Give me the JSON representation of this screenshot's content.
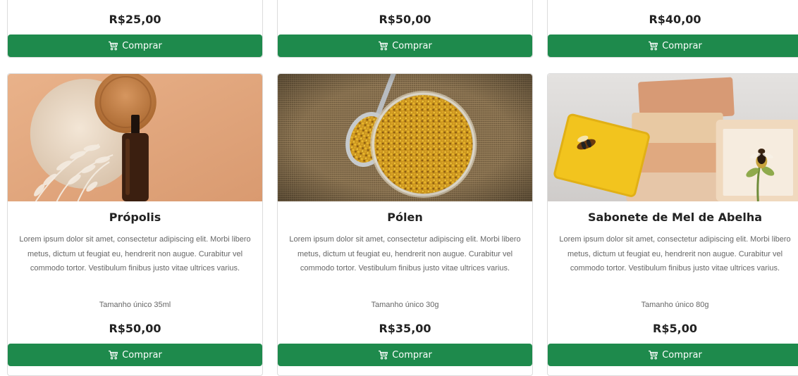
{
  "top_row": [
    {
      "price": "R$25,00",
      "button": "Comprar"
    },
    {
      "price": "R$50,00",
      "button": "Comprar"
    },
    {
      "price": "R$40,00",
      "button": "Comprar"
    }
  ],
  "products": [
    {
      "title": "Própolis",
      "description": "Lorem ipsum dolor sit amet, consectetur adipiscing elit. Morbi libero metus, dictum ut feugiat eu, hendrerit non augue. Curabitur vel commodo tortor. Vestibulum finibus justo vitae ultrices varius.",
      "size": "Tamanho único 35ml",
      "price": "R$50,00",
      "button": "Comprar"
    },
    {
      "title": "Pólen",
      "description": "Lorem ipsum dolor sit amet, consectetur adipiscing elit. Morbi libero metus, dictum ut feugiat eu, hendrerit non augue. Curabitur vel commodo tortor. Vestibulum finibus justo vitae ultrices varius.",
      "size": "Tamanho único 30g",
      "price": "R$35,00",
      "button": "Comprar"
    },
    {
      "title": "Sabonete de Mel de Abelha",
      "description": "Lorem ipsum dolor sit amet, consectetur adipiscing elit. Morbi libero metus, dictum ut feugiat eu, hendrerit non augue. Curabitur vel commodo tortor. Vestibulum finibus justo vitae ultrices varius.",
      "size": "Tamanho único 80g",
      "price": "R$5,00",
      "button": "Comprar"
    }
  ],
  "icons": {
    "button_icon": "cart-icon"
  },
  "colors": {
    "button": "#1e8a4c",
    "button_text": "#ffffff",
    "price": "#222222",
    "description": "#666666"
  }
}
